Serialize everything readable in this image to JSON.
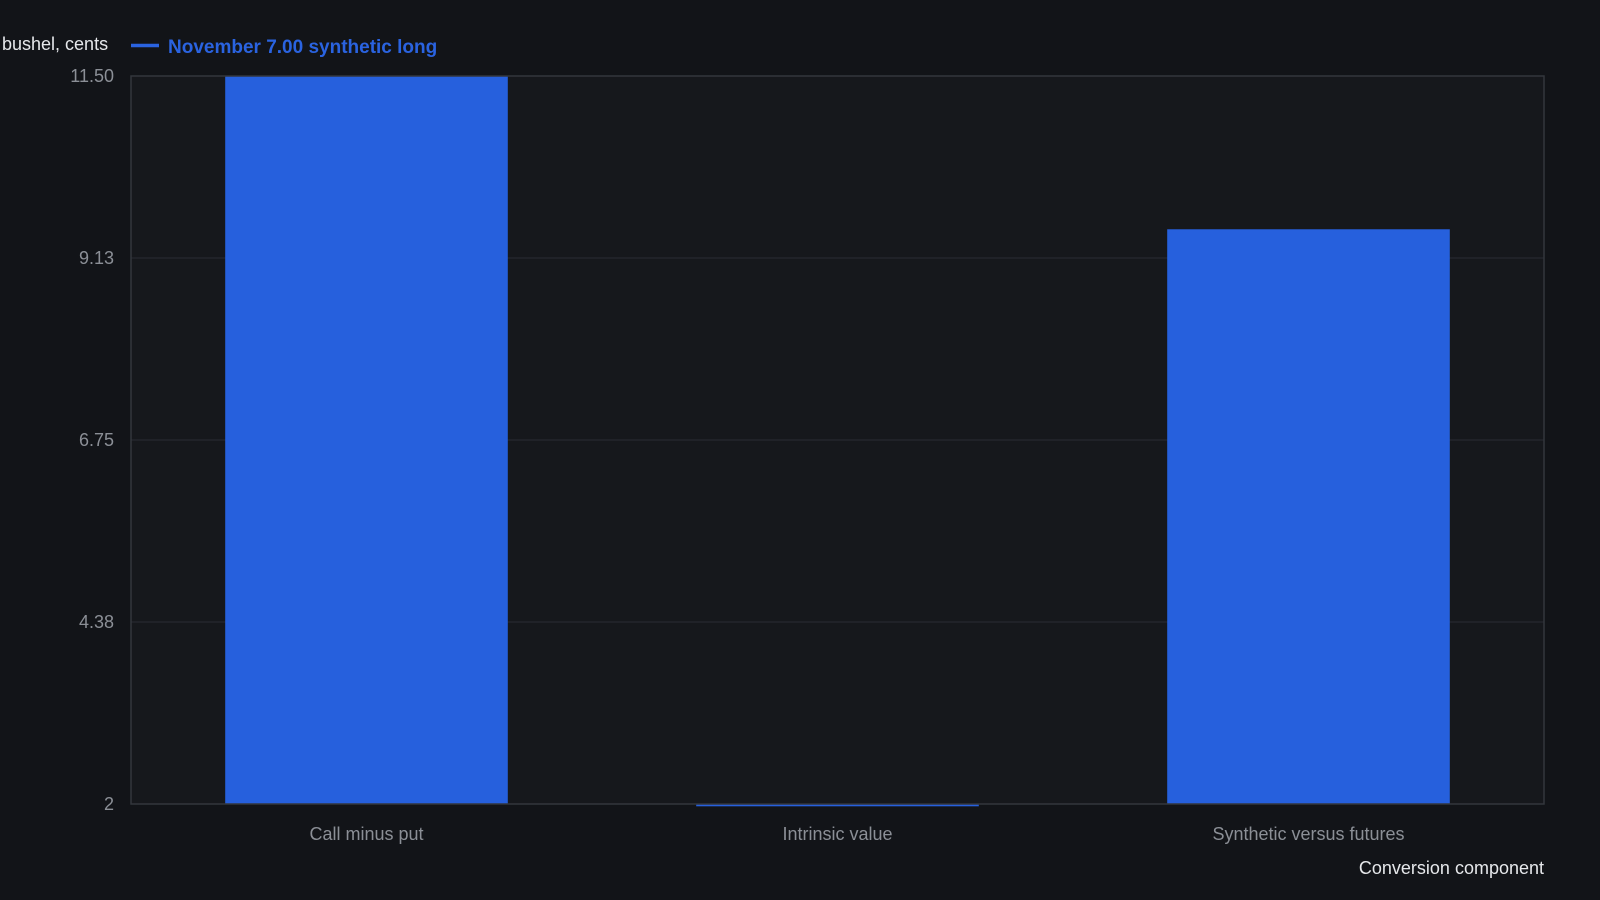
{
  "chart_data": {
    "type": "bar",
    "ylabel": "bushel, cents",
    "xlabel": "Conversion component",
    "categories": [
      "Call minus put",
      "Intrinsic value",
      "Synthetic versus futures"
    ],
    "series": [
      {
        "name": "November 7.00 synthetic long",
        "values": [
          11.5,
          1.97,
          9.5
        ]
      }
    ],
    "ylim": [
      2,
      11.5
    ],
    "yticks": [
      "2",
      "4.38",
      "6.75",
      "9.13",
      "11.50"
    ],
    "ytick_values": [
      2,
      4.375,
      6.75,
      9.125,
      11.5
    ],
    "grid": true,
    "legend_position": "top-left",
    "colors": {
      "bar": "#2660dd",
      "legend": "#2a63e0",
      "grid": "#2a2d33",
      "frame": "#33363c",
      "plot_bg": "#16181c",
      "page_bg": "#121418"
    }
  }
}
